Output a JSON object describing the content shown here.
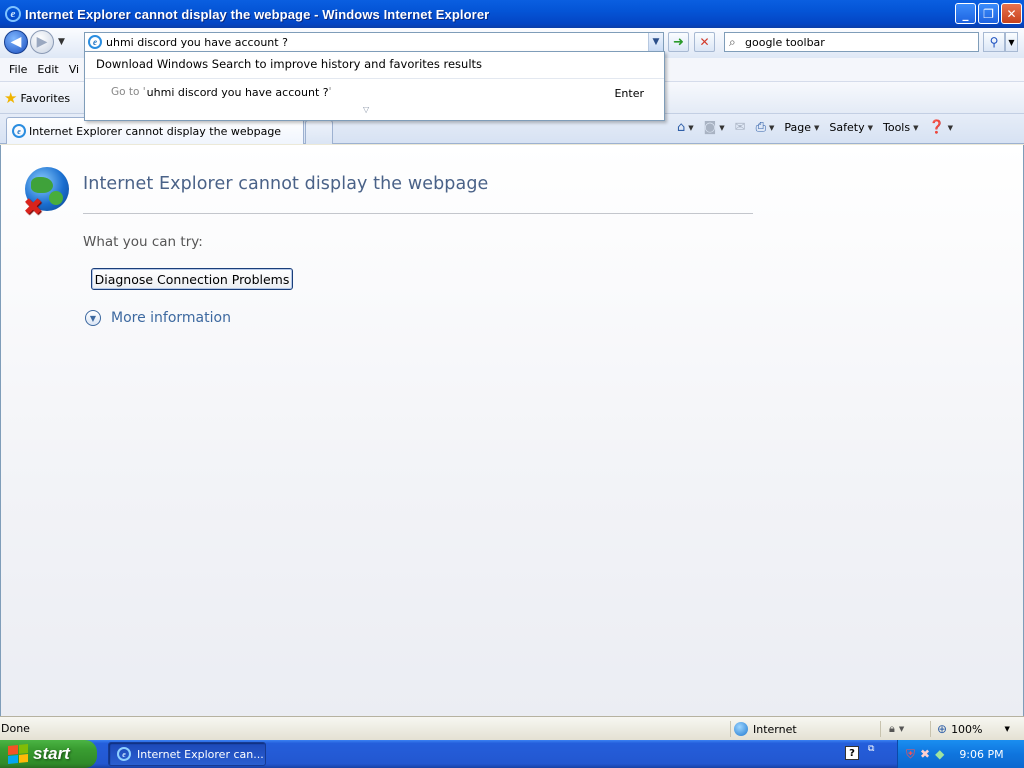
{
  "window": {
    "title": "Internet Explorer cannot display the webpage - Windows Internet Explorer",
    "buttons": {
      "minimize": "_",
      "restore": "❐",
      "close": "✕"
    }
  },
  "nav": {
    "back_icon": "back-arrow-icon",
    "forward_icon": "forward-arrow-icon"
  },
  "address": {
    "value": "uhmi discord you have account ?"
  },
  "search": {
    "value": "google toolbar"
  },
  "autocomplete": {
    "hint": "Download Windows Search to improve history and favorites results",
    "goto_prefix": "Go to '",
    "goto_value": "uhmi discord you have account ?",
    "goto_suffix": "'",
    "enter_label": "Enter"
  },
  "menubar": {
    "items": [
      "File",
      "Edit",
      "Vi"
    ]
  },
  "favorites": {
    "label": "Favorites"
  },
  "tabs": [
    {
      "label": "Internet Explorer cannot display the webpage"
    }
  ],
  "commandbar": {
    "page": "Page",
    "safety": "Safety",
    "tools": "Tools"
  },
  "content": {
    "title": "Internet Explorer cannot display the webpage",
    "try_label": "What you can try:",
    "diagnose_button": "Diagnose Connection Problems",
    "more_info": "More information"
  },
  "status": {
    "text": "Done",
    "zone": "Internet",
    "zoom": "100%"
  },
  "taskbar": {
    "start": "start",
    "item": "Internet Explorer can...",
    "clock": "9:06 PM"
  },
  "colors": {
    "titlebar": "#0454d6",
    "error_title": "#4a6288",
    "link": "#3d69a0",
    "start_green": "#3a9e32"
  }
}
